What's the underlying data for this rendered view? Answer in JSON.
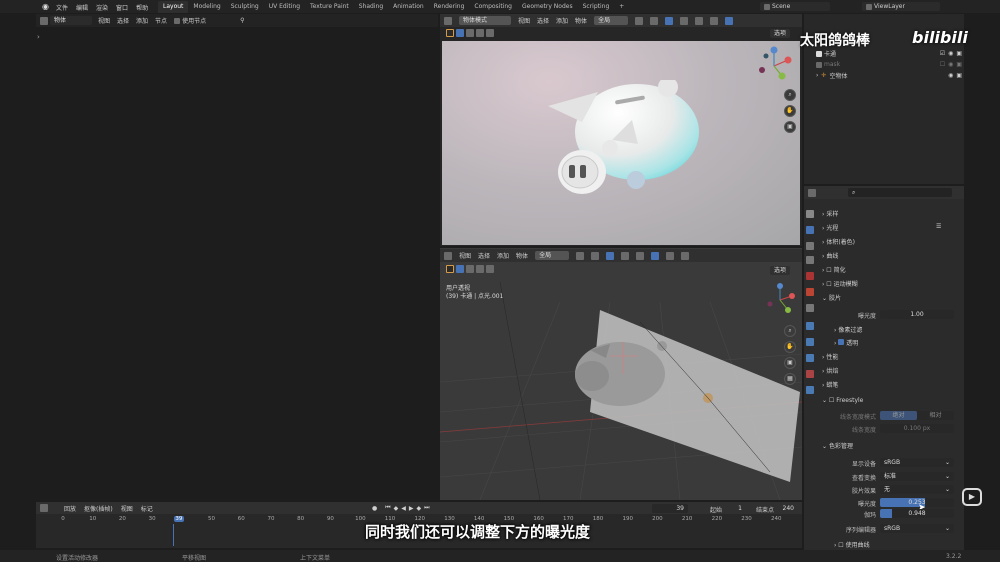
{
  "topbar": {
    "menus": [
      "文件",
      "编辑",
      "渲染",
      "窗口",
      "帮助"
    ],
    "workspaces": [
      "Layout",
      "Modeling",
      "Sculpting",
      "UV Editing",
      "Texture Paint",
      "Shading",
      "Animation",
      "Rendering",
      "Compositing",
      "Geometry Nodes",
      "Scripting"
    ],
    "active_workspace": "Layout",
    "scene": "Scene",
    "view_layer": "ViewLayer"
  },
  "left_editor": {
    "mode": "物体",
    "menus": [
      "视图",
      "选择",
      "添加",
      "节点"
    ],
    "use_nodes": "使用节点"
  },
  "viewport_top": {
    "mode": "物体模式",
    "menus": [
      "视图",
      "选择",
      "添加",
      "物体"
    ],
    "transform": "全局",
    "overlay_label": "选项"
  },
  "viewport_bottom": {
    "menus": [
      "视图",
      "选择",
      "添加",
      "物体"
    ],
    "transform": "全局",
    "overlay_label": "选项",
    "view_name": "用户透视",
    "view_info": "(39) 卡通 | 点光.001"
  },
  "outliner": {
    "items": [
      {
        "name": "卡通"
      },
      {
        "name": "mask"
      },
      {
        "name": "空物体"
      }
    ]
  },
  "properties": {
    "search_placeholder": "",
    "sections": {
      "sampling": "采样",
      "light_paths": "光程",
      "volumes": "体积(着色)",
      "curves": "曲线",
      "simplify": "简化",
      "motion_blur": "运动模糊",
      "film": "胶片",
      "exposure_label": "曝光度",
      "exposure_value": "1.00",
      "pixel_filter": "像素过滤",
      "transparent": "透明",
      "performance": "性能",
      "bake": "烘焙",
      "grease_pencil": "蜡笔",
      "freestyle": "Freestyle",
      "line_mode_label": "线条宽度模式",
      "line_mode_abs": "绝对",
      "line_mode_rel": "相对",
      "line_width_label": "线条宽度",
      "line_width_value": "0.100 px",
      "color_management": "色彩管理",
      "display_device_label": "显示设备",
      "display_device_value": "sRGB",
      "view_transform_label": "查看变换",
      "view_transform_value": "标准",
      "look_label": "胶片效果",
      "look_value": "无",
      "cm_exposure_label": "曝光度",
      "cm_exposure_value": "0.253",
      "gamma_label": "伽玛",
      "gamma_value": "0.948",
      "sequencer_label": "序列编辑器",
      "sequencer_value": "sRGB",
      "use_curves": "使用曲线"
    }
  },
  "timeline": {
    "menus": [
      "回放",
      "抠像(插帧)",
      "视图",
      "标记"
    ],
    "current_frame": "39",
    "start_label": "起始",
    "start_value": "1",
    "end_label": "结束点",
    "end_value": "240",
    "ticks": [
      "0",
      "10",
      "20",
      "30",
      "39",
      "50",
      "60",
      "70",
      "80",
      "90",
      "100",
      "110",
      "120",
      "130",
      "140",
      "150",
      "160",
      "170",
      "180",
      "190",
      "200",
      "210",
      "220",
      "230",
      "240"
    ]
  },
  "statusbar": {
    "left": "设置活动修改器",
    "mid": "平移视图",
    "right": "上下文菜单",
    "version": "3.2.2"
  },
  "overlay": {
    "subtitle": "同时我们还可以调整下方的曝光度",
    "watermark": "太阳鸽鸽棒",
    "brand": "bilibili"
  },
  "colors": {
    "accent": "#4772b3",
    "bg": "#1d1d1d",
    "header": "#303030"
  }
}
